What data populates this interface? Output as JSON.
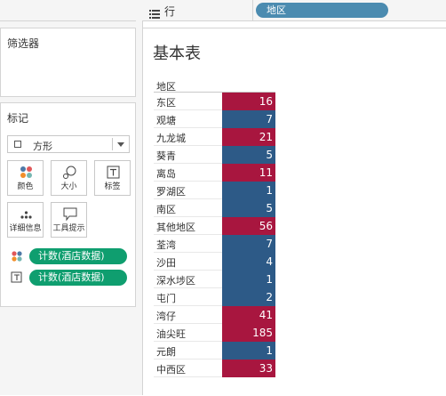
{
  "rows_shelf": {
    "label": "行",
    "pill": "地区"
  },
  "filters_card": {
    "title": "筛选器"
  },
  "marks_card": {
    "title": "标记",
    "mark_type": "方形",
    "buttons": [
      {
        "label": "颜色",
        "icon": "color-dots-icon"
      },
      {
        "label": "大小",
        "icon": "size-icon"
      },
      {
        "label": "标签",
        "icon": "text-label-icon"
      },
      {
        "label": "详细信息",
        "icon": "detail-dots-icon"
      },
      {
        "label": "工具提示",
        "icon": "tooltip-icon"
      }
    ],
    "pills": [
      {
        "label": "计数(酒店数据)",
        "icon": "color-dots-icon"
      },
      {
        "label": "计数(酒店数据)",
        "icon": "text-label-icon"
      }
    ]
  },
  "sheet": {
    "title": "基本表",
    "column_header": "地区",
    "rows": [
      {
        "region": "东区",
        "value": "16"
      },
      {
        "region": "观塘",
        "value": "7"
      },
      {
        "region": "九龙城",
        "value": "21"
      },
      {
        "region": "葵青",
        "value": "5"
      },
      {
        "region": "离岛",
        "value": "11"
      },
      {
        "region": "罗湖区",
        "value": "1"
      },
      {
        "region": "南区",
        "value": "5"
      },
      {
        "region": "其他地区",
        "value": "56"
      },
      {
        "region": "荃湾",
        "value": "7"
      },
      {
        "region": "沙田",
        "value": "4"
      },
      {
        "region": "深水埗区",
        "value": "1"
      },
      {
        "region": "屯门",
        "value": "2"
      },
      {
        "region": "湾仔",
        "value": "41"
      },
      {
        "region": "油尖旺",
        "value": "185"
      },
      {
        "region": "元朗",
        "value": "1"
      },
      {
        "region": "中西区",
        "value": "33"
      }
    ]
  },
  "colors": {
    "high": "#a8163f",
    "low": "#2d5a87",
    "pill_green": "#0f9e6f",
    "pill_blue": "#4b8bb0",
    "color_threshold": 10
  }
}
